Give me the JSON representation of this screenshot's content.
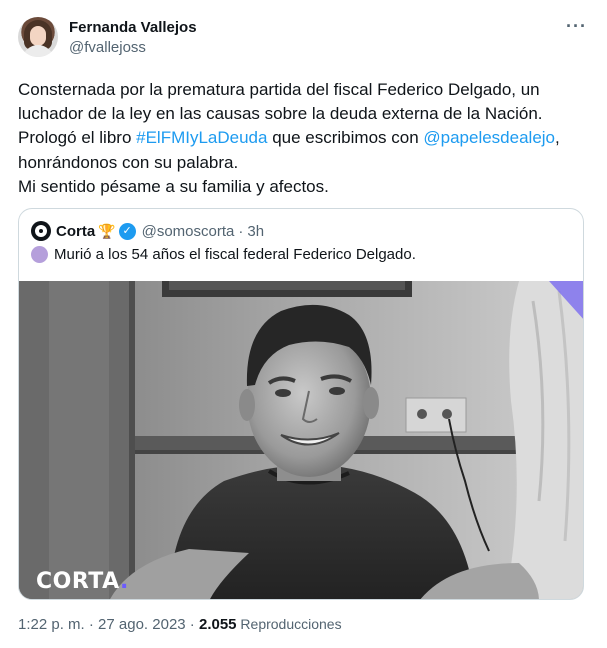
{
  "author": {
    "display_name": "Fernanda Vallejos",
    "handle": "@fvallejoss",
    "avatar_icon": "person-avatar"
  },
  "more_menu": {
    "label": "···",
    "icon": "more-horizontal-icon"
  },
  "tweet": {
    "lines": [
      {
        "text": "Consternada por la prematura partida del fiscal Federico Delgado, un"
      },
      {
        "text": "luchador de la ley en las causas sobre la deuda externa de la Nación."
      },
      {
        "before": "Prologó el libro ",
        "hashtag": "#ElFMIyLaDeuda",
        "middle": " que escribimos con ",
        "mention": "@papelesdealejo",
        "after": ","
      },
      {
        "text": "honrándonos con su palabra."
      },
      {
        "text": "Mi sentido pésame a su familia y afectos."
      }
    ]
  },
  "quote": {
    "name": "Corta",
    "trophy": "🏆",
    "verified_icon": "verified-badge-icon",
    "verified_mark": "✓",
    "handle": "@somoscorta",
    "separator": "·",
    "time": "3h",
    "text": "Murió a los 54 años el fiscal federal Federico Delgado.",
    "bullet_color": "#b59fdb",
    "image": {
      "alt": "Black and white photo of a smiling man in a dark t-shirt",
      "logo_text": "CORTA",
      "logo_dot": ".",
      "logo_dot_color": "#6b5bff"
    }
  },
  "meta": {
    "time": "1:22 p. m.",
    "separator1": " · ",
    "date": "27 ago. 2023",
    "separator2": " · ",
    "views_count": "2.055",
    "views_label": " Reproducciones"
  },
  "colors": {
    "link": "#1d9bf0",
    "secondary_text": "#536471",
    "border": "#cfd9de"
  }
}
